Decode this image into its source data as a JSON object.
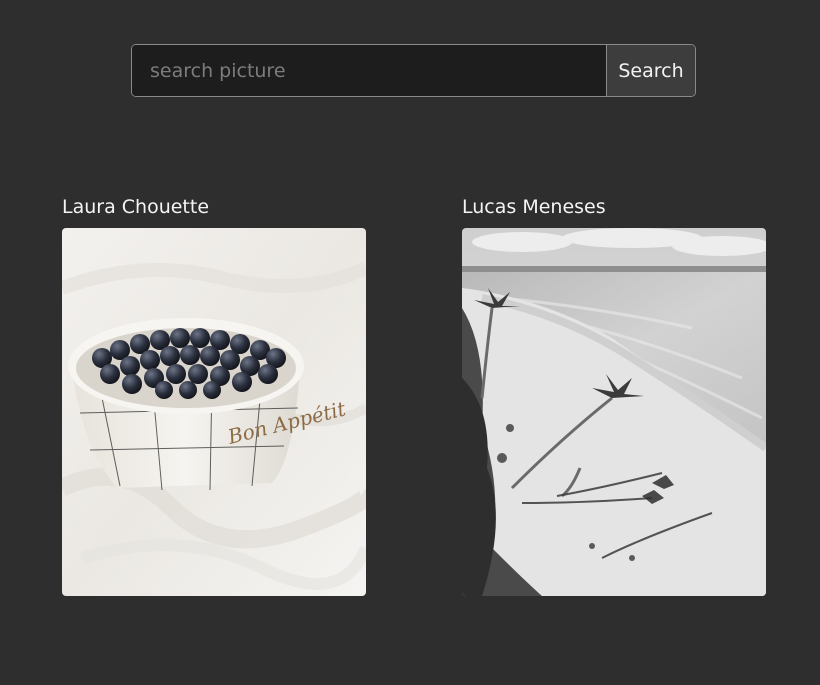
{
  "search": {
    "placeholder": "search picture",
    "value": "",
    "button_label": "Search"
  },
  "gallery": {
    "items": [
      {
        "author": "Laura Chouette",
        "image_subject": "blueberries-bowl-image",
        "cup_text": "Bon Appétit"
      },
      {
        "author": "Lucas Meneses",
        "image_subject": "beach-palm-trees-image"
      }
    ]
  },
  "colors": {
    "background": "#2e2e2e",
    "input_background": "#1d1d1d",
    "button_background": "#3d3d3d",
    "text": "#f4f4f4"
  }
}
